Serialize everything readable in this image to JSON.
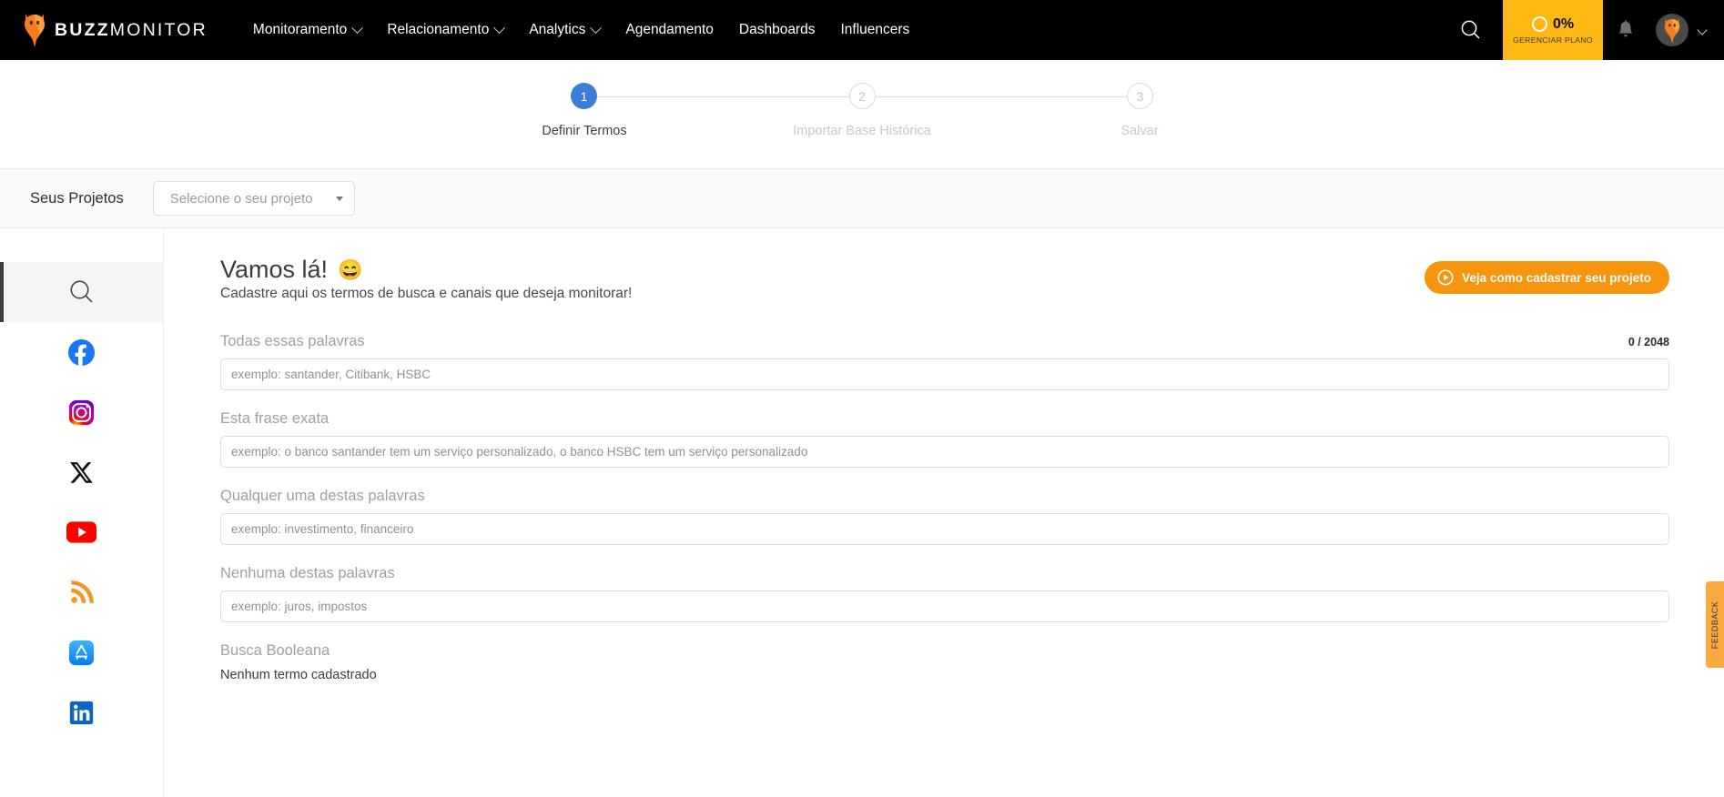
{
  "topnav": {
    "logo": {
      "icon": "buzzmonitor-bird-logo",
      "bold": "BUZZ",
      "light": "MONITOR"
    },
    "links": [
      {
        "label": "Monitoramento",
        "has_dropdown": true
      },
      {
        "label": "Relacionamento",
        "has_dropdown": true
      },
      {
        "label": "Analytics",
        "has_dropdown": true
      },
      {
        "label": "Agendamento",
        "has_dropdown": false
      },
      {
        "label": "Dashboards",
        "has_dropdown": false
      },
      {
        "label": "Influencers",
        "has_dropdown": false
      }
    ],
    "search_icon": "search-icon",
    "plan": {
      "percent": "0%",
      "label": "GERENCIAR PLANO",
      "color": "#FDB813"
    },
    "bell_icon": "notification-bell-icon",
    "avatar_icon": "user-avatar"
  },
  "stepper": {
    "accent_color": "#3b7dd8",
    "steps": [
      {
        "number": "1",
        "label": "Definir Termos",
        "state": "active"
      },
      {
        "number": "2",
        "label": "Importar Base Histórica",
        "state": "idle"
      },
      {
        "number": "3",
        "label": "Salvar",
        "state": "idle"
      }
    ]
  },
  "projects_bar": {
    "label": "Seus Projetos",
    "select_value": "Selecione o seu projeto"
  },
  "sidebar": {
    "items": [
      {
        "name": "search",
        "icon": "search-icon",
        "active": true
      },
      {
        "name": "facebook",
        "icon": "facebook-icon",
        "active": false
      },
      {
        "name": "instagram",
        "icon": "instagram-icon",
        "active": false
      },
      {
        "name": "x-twitter",
        "icon": "x-twitter-icon",
        "active": false
      },
      {
        "name": "youtube",
        "icon": "youtube-icon",
        "active": false
      },
      {
        "name": "rss",
        "icon": "rss-icon",
        "active": false
      },
      {
        "name": "appstore",
        "icon": "appstore-icon",
        "active": false
      },
      {
        "name": "linkedin",
        "icon": "linkedin-icon",
        "active": false
      }
    ]
  },
  "main": {
    "title": "Vamos lá!",
    "emoji": "😄",
    "subtitle": "Cadastre aqui os termos de busca e canais que deseja monitorar!",
    "video_button": {
      "label": "Veja como cadastrar seu projeto",
      "icon": "play-circle-icon",
      "color": "#F7960E"
    },
    "fields": [
      {
        "label": "Todas essas palavras",
        "placeholder": "exemplo: santander, Citibank, HSBC",
        "value": "",
        "counter": "0 / 2048"
      },
      {
        "label": "Esta frase exata",
        "placeholder": "exemplo: o banco santander tem um serviço personalizado, o banco HSBC tem um serviço personalizado",
        "value": "",
        "counter": ""
      },
      {
        "label": "Qualquer uma destas palavras",
        "placeholder": "exemplo: investimento, financeiro",
        "value": "",
        "counter": ""
      },
      {
        "label": "Nenhuma destas palavras",
        "placeholder": "exemplo: juros, impostos",
        "value": "",
        "counter": ""
      }
    ],
    "boolean_section": {
      "label": "Busca Booleana",
      "empty_text": "Nenhum termo cadastrado"
    }
  },
  "feedback_tab": {
    "label": "FEEDBACK",
    "color": "#F9A93F"
  }
}
